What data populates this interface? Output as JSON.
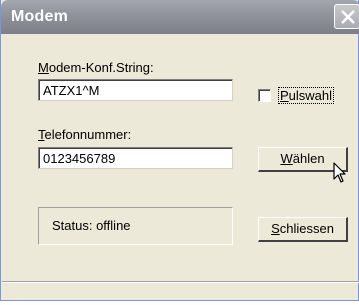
{
  "window": {
    "title": "Modem"
  },
  "fields": {
    "conf_string": {
      "label_first": "M",
      "label_rest": "odem-Konf.String:",
      "value": "ATZX1^M"
    },
    "phone": {
      "label_first": "T",
      "label_rest": "elefonnummer:",
      "value": "0123456789"
    }
  },
  "pulswahl": {
    "label_first": "P",
    "label_rest": "ulswahl",
    "checked": false
  },
  "buttons": {
    "waehlen": {
      "first": "W",
      "rest": "ählen"
    },
    "schliessen": {
      "first": "S",
      "rest": "chliessen"
    }
  },
  "status": {
    "text": "Status:  offline"
  },
  "icons": {
    "close": "close-icon",
    "cursor": "mouse-pointer-icon"
  }
}
